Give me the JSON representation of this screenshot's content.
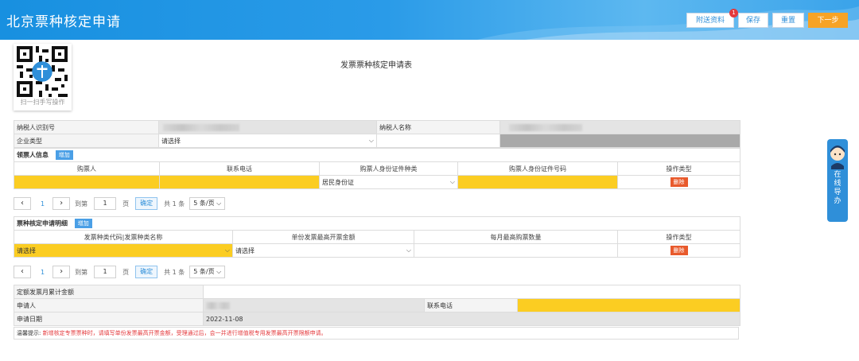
{
  "header": {
    "title": "北京票种核定申请",
    "buttons": {
      "attach": "附送资料",
      "save": "保存",
      "reset": "重置",
      "next": "下一步"
    },
    "attach_badge": "1"
  },
  "qr": {
    "caption": "扫一扫手写操作"
  },
  "form_title": "发票票种核定申请表",
  "taxpayer": {
    "id_label": "纳税人识别号",
    "name_label": "纳税人名称",
    "type_label": "企业类型",
    "type_value": "请选择"
  },
  "buyer_section": {
    "title": "领票人信息",
    "add": "增加",
    "columns": [
      "购票人",
      "联系电话",
      "购票人身份证件种类",
      "购票人身份证件号码",
      "操作类型"
    ],
    "row": {
      "id_type": "居民身份证",
      "delete": "删除"
    }
  },
  "pager": {
    "page": "1",
    "goto_prefix": "到第",
    "goto_value": "1",
    "goto_suffix": "页",
    "confirm": "确定",
    "total": "共 1 条",
    "page_size": "5 条/页"
  },
  "ticket_section": {
    "title": "票种核定申请明细",
    "add": "增加",
    "columns": [
      "发票种类代码|发票种类名称",
      "单份发票最高开票金额",
      "每月最高购票数量",
      "操作类型"
    ],
    "row": {
      "kind": "请选择",
      "max_amount": "请选择",
      "delete": "删除"
    }
  },
  "bottom": {
    "quota_label": "定额发票月累计金额",
    "applicant_label": "申请人",
    "phone_label": "联系电话",
    "date_label": "申请日期",
    "date_value": "2022-11-08"
  },
  "tip": {
    "prefix": "温馨提示:",
    "message": "新增核定专票票种时，请填写单份发票最高开票金额，受理通过后，会一并进行增值税专用发票最高开票限额申请。"
  },
  "online_guide": "在线导办",
  "colors": {
    "header_blue": "#1890e0",
    "highlight_yellow": "#fbcd22",
    "next_orange": "#f7a325",
    "delete_red": "#e85a2c"
  }
}
